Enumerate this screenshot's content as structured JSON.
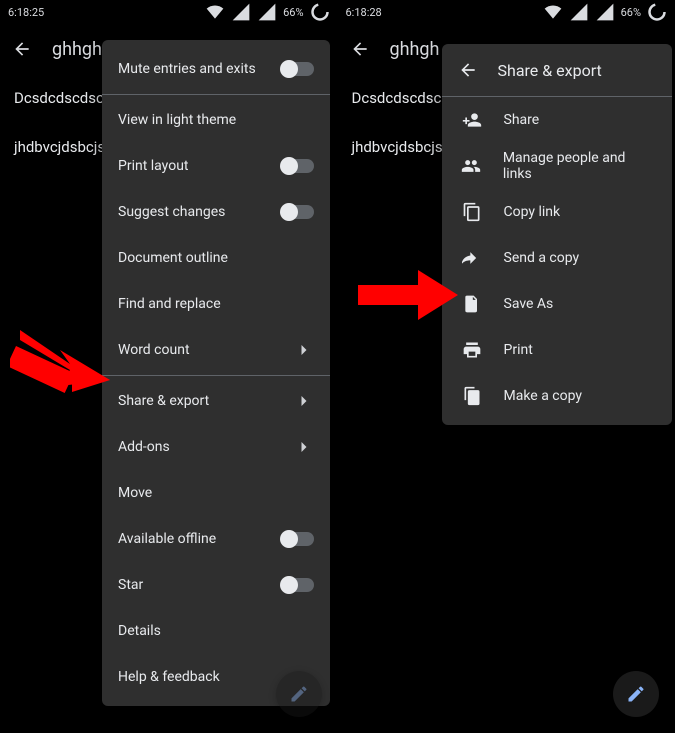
{
  "screens": [
    {
      "statusbar": {
        "time": "6:18:25",
        "battery": "66%"
      },
      "appbar": {
        "title": "ghhgh"
      },
      "doc": {
        "line1": "Dcsdcdscdscs",
        "line2": "jhdbvcjdsbcjs"
      },
      "menu": {
        "mute": "Mute entries and exits",
        "light": "View in light theme",
        "printlayout": "Print layout",
        "suggest": "Suggest changes",
        "outline": "Document outline",
        "find": "Find and replace",
        "wordcount": "Word count",
        "shareexport": "Share & export",
        "addons": "Add-ons",
        "move": "Move",
        "offline": "Available offline",
        "star": "Star",
        "details": "Details",
        "help": "Help & feedback"
      }
    },
    {
      "statusbar": {
        "time": "6:18:28",
        "battery": "66%"
      },
      "appbar": {
        "title": "ghhgh"
      },
      "doc": {
        "line1": "Dcsdcdscdscs",
        "line2": "jhdbvcjdsbcjs"
      },
      "share": {
        "title": "Share & export",
        "share": "Share",
        "manage": "Manage people and links",
        "copylink": "Copy link",
        "sendcopy": "Send a copy",
        "saveas": "Save As",
        "print": "Print",
        "makecopy": "Make a copy"
      }
    }
  ]
}
